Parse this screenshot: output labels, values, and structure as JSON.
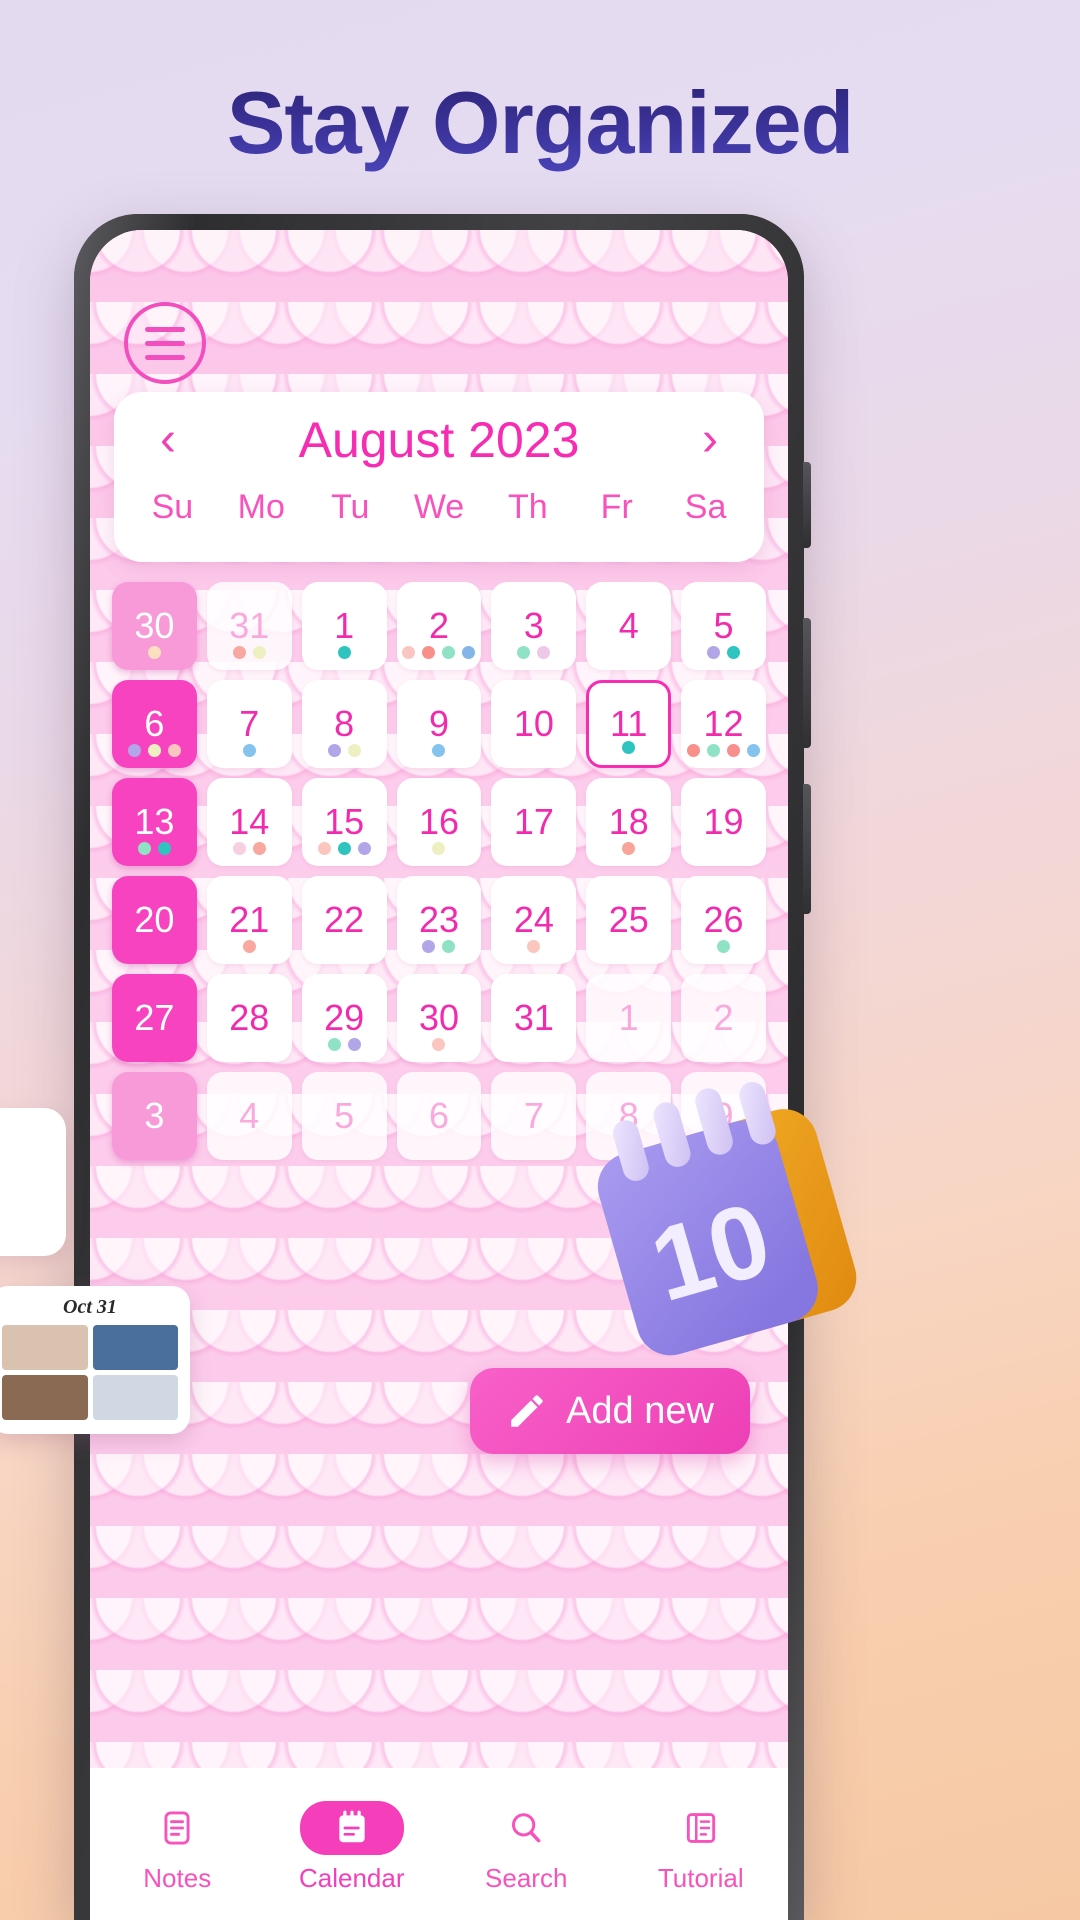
{
  "headline": "Stay Organized",
  "app": {
    "menu_icon": "hamburger-icon",
    "calendar": {
      "prev_label": "‹",
      "next_label": "›",
      "month_title": "August 2023",
      "weekdays": [
        "Su",
        "Mo",
        "Tu",
        "We",
        "Th",
        "Fr",
        "Sa"
      ],
      "weeks": [
        [
          {
            "day": "30",
            "out": true,
            "sunday": true,
            "today": false,
            "dots": [
              "#fadfc0"
            ]
          },
          {
            "day": "31",
            "out": true,
            "sunday": false,
            "today": false,
            "dots": [
              "#f8a8a0",
              "#eef0c2"
            ]
          },
          {
            "day": "1",
            "out": false,
            "sunday": false,
            "today": false,
            "dots": [
              "#2fc4c0"
            ]
          },
          {
            "day": "2",
            "out": false,
            "sunday": false,
            "today": false,
            "dots": [
              "#fbc6c2",
              "#f98f8a",
              "#8fe3c4",
              "#84b5e8"
            ]
          },
          {
            "day": "3",
            "out": false,
            "sunday": false,
            "today": false,
            "dots": [
              "#8fe3c4",
              "#eec8e8"
            ]
          },
          {
            "day": "4",
            "out": false,
            "sunday": false,
            "today": false,
            "dots": []
          },
          {
            "day": "5",
            "out": false,
            "sunday": false,
            "today": false,
            "dots": [
              "#b3a6e8",
              "#2fc4c0"
            ]
          }
        ],
        [
          {
            "day": "6",
            "out": false,
            "sunday": true,
            "today": false,
            "dots": [
              "#b3a6e8",
              "#eef0c2",
              "#fbc6bd"
            ]
          },
          {
            "day": "7",
            "out": false,
            "sunday": false,
            "today": false,
            "dots": [
              "#84c3ee"
            ]
          },
          {
            "day": "8",
            "out": false,
            "sunday": false,
            "today": false,
            "dots": [
              "#b3a6e8",
              "#eef0c2"
            ]
          },
          {
            "day": "9",
            "out": false,
            "sunday": false,
            "today": false,
            "dots": [
              "#84c3ee"
            ]
          },
          {
            "day": "10",
            "out": false,
            "sunday": false,
            "today": false,
            "dots": []
          },
          {
            "day": "11",
            "out": false,
            "sunday": false,
            "today": true,
            "dots": [
              "#2fc4c0"
            ]
          },
          {
            "day": "12",
            "out": false,
            "sunday": false,
            "today": false,
            "dots": [
              "#f98f8a",
              "#8fe3c4",
              "#f98f8a",
              "#84c3ee"
            ]
          }
        ],
        [
          {
            "day": "13",
            "out": false,
            "sunday": true,
            "today": false,
            "dots": [
              "#8fe3c4",
              "#2fc4c0"
            ]
          },
          {
            "day": "14",
            "out": false,
            "sunday": false,
            "today": false,
            "dots": [
              "#f6cfe0",
              "#f9a8a0"
            ]
          },
          {
            "day": "15",
            "out": false,
            "sunday": false,
            "today": false,
            "dots": [
              "#fbc6bd",
              "#2fc4c0",
              "#b3a6e8"
            ]
          },
          {
            "day": "16",
            "out": false,
            "sunday": false,
            "today": false,
            "dots": [
              "#eef0c2"
            ]
          },
          {
            "day": "17",
            "out": false,
            "sunday": false,
            "today": false,
            "dots": []
          },
          {
            "day": "18",
            "out": false,
            "sunday": false,
            "today": false,
            "dots": [
              "#f9a49a"
            ]
          },
          {
            "day": "19",
            "out": false,
            "sunday": false,
            "today": false,
            "dots": []
          }
        ],
        [
          {
            "day": "20",
            "out": false,
            "sunday": true,
            "today": false,
            "dots": []
          },
          {
            "day": "21",
            "out": false,
            "sunday": false,
            "today": false,
            "dots": [
              "#f9a8a0"
            ]
          },
          {
            "day": "22",
            "out": false,
            "sunday": false,
            "today": false,
            "dots": []
          },
          {
            "day": "23",
            "out": false,
            "sunday": false,
            "today": false,
            "dots": [
              "#b3a6e8",
              "#8fe3c4"
            ]
          },
          {
            "day": "24",
            "out": false,
            "sunday": false,
            "today": false,
            "dots": [
              "#fbc6bd"
            ]
          },
          {
            "day": "25",
            "out": false,
            "sunday": false,
            "today": false,
            "dots": []
          },
          {
            "day": "26",
            "out": false,
            "sunday": false,
            "today": false,
            "dots": [
              "#8fe3c4"
            ]
          }
        ],
        [
          {
            "day": "27",
            "out": false,
            "sunday": true,
            "today": false,
            "dots": []
          },
          {
            "day": "28",
            "out": false,
            "sunday": false,
            "today": false,
            "dots": []
          },
          {
            "day": "29",
            "out": false,
            "sunday": false,
            "today": false,
            "dots": [
              "#8fe3c4",
              "#b3a6e8"
            ]
          },
          {
            "day": "30",
            "out": false,
            "sunday": false,
            "today": false,
            "dots": [
              "#fbc6bd"
            ]
          },
          {
            "day": "31",
            "out": false,
            "sunday": false,
            "today": false,
            "dots": []
          },
          {
            "day": "1",
            "out": true,
            "sunday": false,
            "today": false,
            "dots": []
          },
          {
            "day": "2",
            "out": true,
            "sunday": false,
            "today": false,
            "dots": []
          }
        ],
        [
          {
            "day": "3",
            "out": true,
            "sunday": true,
            "today": false,
            "dots": []
          },
          {
            "day": "4",
            "out": true,
            "sunday": false,
            "today": false,
            "dots": []
          },
          {
            "day": "5",
            "out": true,
            "sunday": false,
            "today": false,
            "dots": []
          },
          {
            "day": "6",
            "out": true,
            "sunday": false,
            "today": false,
            "dots": []
          },
          {
            "day": "7",
            "out": true,
            "sunday": false,
            "today": false,
            "dots": []
          },
          {
            "day": "8",
            "out": true,
            "sunday": false,
            "today": false,
            "dots": []
          },
          {
            "day": "9",
            "out": true,
            "sunday": false,
            "today": false,
            "dots": []
          }
        ]
      ]
    },
    "add_new": {
      "label": "Add new",
      "icon": "pencil-icon"
    },
    "bottom_nav": [
      {
        "label": "Notes",
        "icon": "notes-icon",
        "active": false
      },
      {
        "label": "Calendar",
        "icon": "calendar-icon",
        "active": true
      },
      {
        "label": "Search",
        "icon": "search-icon",
        "active": false
      },
      {
        "label": "Tutorial",
        "icon": "tutorial-icon",
        "active": false
      }
    ]
  },
  "note_card": {
    "date": "Oct 31",
    "thumbs": [
      "#d9c3b0",
      "#4a6f9c",
      "#8a6a52",
      "#cfd8e3"
    ]
  },
  "decor": {
    "calendar_3d_number": "10"
  },
  "colors": {
    "accent": "#f62cb3",
    "accent_soft": "#f852bc",
    "headline": "#2c2275",
    "screen_bg": "#fcc6e9"
  }
}
